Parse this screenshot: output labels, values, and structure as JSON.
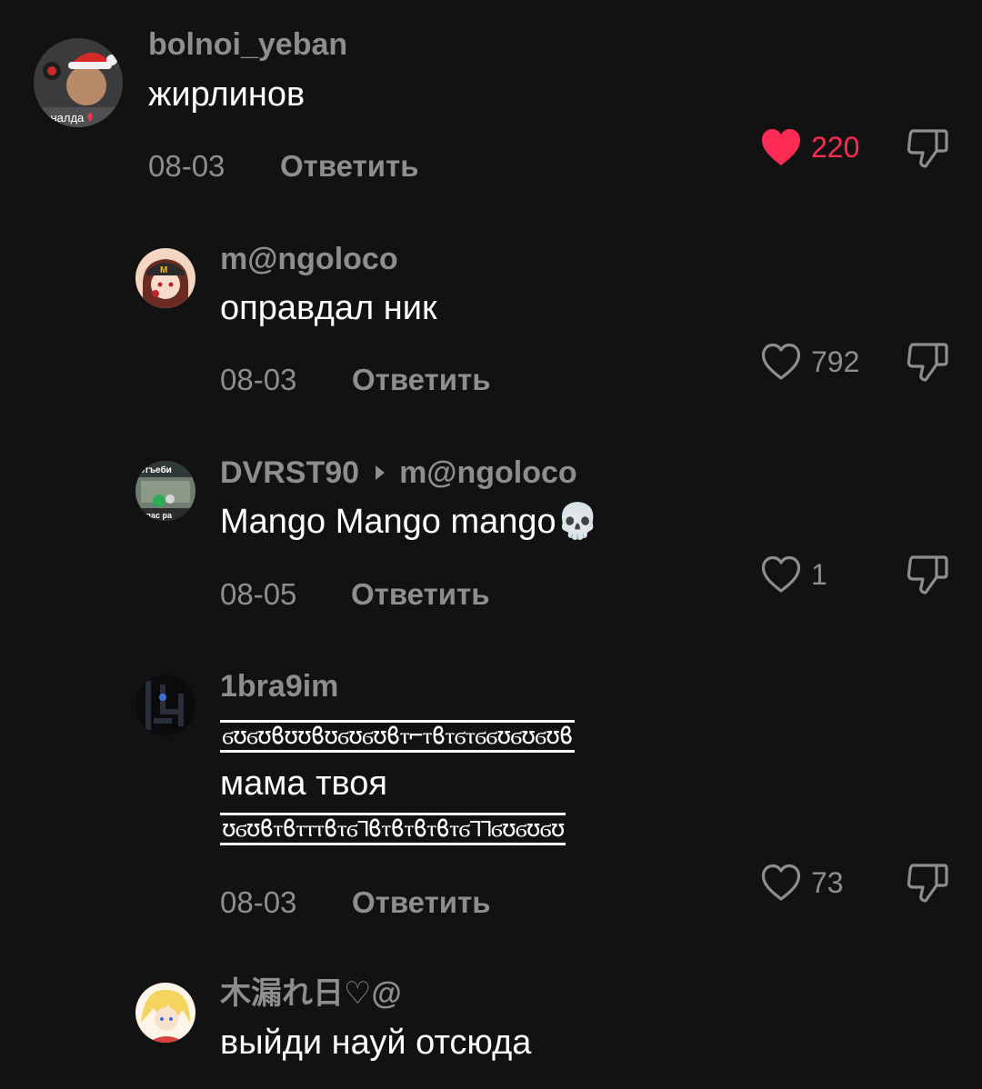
{
  "comments": [
    {
      "username": "bolnoi_yeban",
      "text": "жирлинов",
      "date": "08-03",
      "reply_label": "Ответить",
      "likes": "220",
      "liked": true,
      "avatar_caption": "роналда"
    },
    {
      "username": "m@ngoloco",
      "text": "оправдал ник",
      "date": "08-03",
      "reply_label": "Ответить",
      "likes": "792",
      "liked": false
    },
    {
      "username": "DVRST90",
      "reply_to": "m@ngoloco",
      "text": "Mango Mango mango💀",
      "date": "08-05",
      "reply_label": "Ответить",
      "likes": "1",
      "liked": false,
      "avatar_caption_top": "отъеби",
      "avatar_caption_bottom": "опас ра"
    },
    {
      "username": "1bra9im",
      "deco_line_1": "ϭʊϭʊϐʊʊϐʊϭʊϭʊϐⲧ⌐ⲧϐⲧϭⲧϭϭʊϭʊϭʊϐ",
      "text": "мама твоя",
      "deco_line_2": "ʊϭʊϐⲧϐⲧⲧⲧϐⲧϭ⅂ϐⲧϐⲧϐⲧϐⲧϭ⅂⅂ϭʊϭʊϭʊ",
      "date": "08-03",
      "reply_label": "Ответить",
      "likes": "73",
      "liked": false
    },
    {
      "username": "木漏れ日♡@",
      "text": "выйди науй отсюда"
    }
  ],
  "colors": {
    "background": "#121212",
    "muted_text": "#8e8e8e",
    "like_active": "#fe2c55"
  },
  "icons": {
    "like": "heart-icon",
    "dislike": "thumbs-down-icon",
    "reply_to": "triangle-right-icon"
  }
}
